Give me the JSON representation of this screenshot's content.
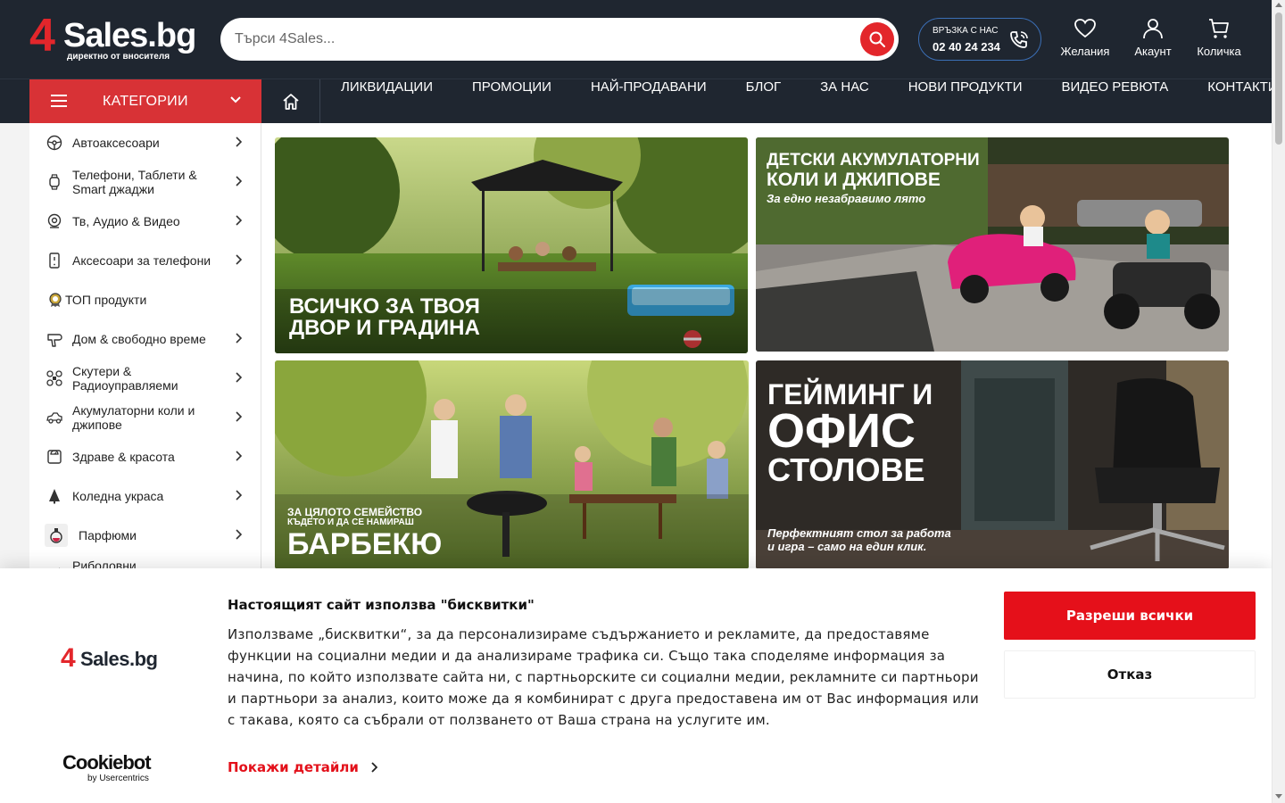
{
  "header": {
    "logo": {
      "prefix": "4",
      "name": "Sales.bg",
      "tagline": "директно от вносителя"
    },
    "search": {
      "placeholder": "Търси 4Sales..."
    },
    "contact": {
      "label": "ВРЪЗКА С НАС",
      "phone": "02 40 24 234"
    },
    "icons": [
      {
        "icon": "heart-icon",
        "label": "Желания"
      },
      {
        "icon": "user-icon",
        "label": "Акаунт"
      },
      {
        "icon": "cart-icon",
        "label": "Количка"
      }
    ]
  },
  "nav": {
    "categories_label": "КАТЕГОРИИ",
    "links": [
      "ЛИКВИДАЦИИ",
      "ПРОМОЦИИ",
      "НАЙ-ПРОДАВАНИ",
      "БЛОГ",
      "ЗА НАС",
      "НОВИ ПРОДУКТИ",
      "ВИДЕО РЕВЮТА",
      "КОНТАКТИ"
    ]
  },
  "sidebar": {
    "items": [
      {
        "label": "Автоаксесоари",
        "icon": "steering-wheel-icon",
        "has_arrow": true
      },
      {
        "label": "Телефони, Таблети & Smart джаджи",
        "icon": "smartwatch-icon",
        "has_arrow": true
      },
      {
        "label": "Тв, Аудио & Видео",
        "icon": "camera-icon",
        "has_arrow": true
      },
      {
        "label": "Аксесоари за телефони",
        "icon": "phone-icon",
        "has_arrow": true
      },
      {
        "label": "ТОП продукти",
        "icon": "badge-icon",
        "has_arrow": false
      },
      {
        "label": "Дом & свободно време",
        "icon": "hairdryer-icon",
        "has_arrow": true
      },
      {
        "label": "Скутери & Радиоуправляеми",
        "icon": "drone-icon",
        "has_arrow": true
      },
      {
        "label": "Акумулаторни коли и джипове",
        "icon": "kids-car-icon",
        "has_arrow": true
      },
      {
        "label": "Здраве & красота",
        "icon": "scale-icon",
        "has_arrow": true
      },
      {
        "label": "Коледна украса",
        "icon": "tree-icon",
        "has_arrow": true
      },
      {
        "label": "Парфюми",
        "icon": "perfume-icon",
        "has_arrow": true
      },
      {
        "label": "Риболовни",
        "icon": "fishing-icon",
        "has_arrow": false
      }
    ]
  },
  "banners": [
    {
      "line1": "ВСИЧКО ЗА ТВОЯ",
      "line2": "ДВОР И ГРАДИНА"
    },
    {
      "line1": "ДЕТСКИ АКУМУЛАТОРНИ",
      "line2": "КОЛИ И ДЖИПОВЕ",
      "sub": "За едно незабравимо лято"
    },
    {
      "pre1": "ЗА ЦЯЛОТО СЕМЕЙСТВО",
      "pre2": "КЪДЕТО И ДА СЕ НАМИРАШ",
      "title": "БАРБЕКЮ"
    },
    {
      "line1": "ГЕЙМИНГ И",
      "line2": "ОФИС",
      "line3": "СТОЛОВЕ",
      "sub1": "Перфектният стол за работа",
      "sub2": "и игра – само на един клик."
    }
  ],
  "cookie": {
    "logo_prefix": "4",
    "logo_name": "Sales.bg",
    "title": "Настоящият сайт използва \"бисквитки\"",
    "text": "Използваме „бисквитки“, за да персонализираме съдържанието и рекламите, да предоставяме функции на социални медии и да анализираме трафика си. Също така споделяме информация за начина, по който използвате сайта ни, с партньорските си социални медии, рекламните си партньори и партньори за анализ, които може да я комбинират с друга предоставена им от Вас информация или с такава, която са събрали от ползването от Ваша страна на услугите им.",
    "details": "Покажи детайли",
    "allow": "Разреши всички",
    "deny": "Отказ",
    "provider": "Cookiebot",
    "provider_sub": "by Usercentrics"
  },
  "colors": {
    "brand_red": "#e3262b",
    "dark": "#1f2630",
    "cookie_red": "#e5101a"
  }
}
